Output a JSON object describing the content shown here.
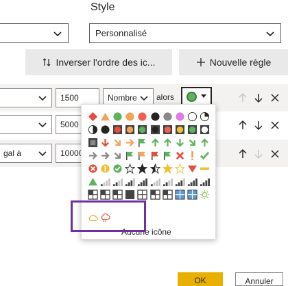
{
  "style": {
    "label": "Style",
    "selected": "Personnalisé"
  },
  "toolbar": {
    "reverse_label": "Inverser l'ordre des ic...",
    "new_rule_label": "Nouvelle règle"
  },
  "rules": [
    {
      "value": "1500",
      "type": "Nombre",
      "then": "alors",
      "icon_color": "#5fb35f"
    },
    {
      "value": "5000"
    },
    {
      "op_partial": "gal à",
      "value": "10000"
    }
  ],
  "icon_picker": {
    "no_icon_label": "Aucune icône",
    "rows": [
      [
        "diamond-red",
        "triangle-orange",
        "circle-green",
        "circle-orange",
        "circle-red",
        "circle-black",
        "circle-dark",
        "circle-pink",
        "circle-empty",
        "circle-quarter"
      ],
      [
        "circle-half",
        "circle-black-full",
        "circle-red-boxed",
        "circle-orange-boxed",
        "circle-green-boxed",
        "circle-black-boxed",
        "circle-red-boxed2",
        "circle-orange-boxed2",
        "circle-green-boxed2",
        "circle-empty-boxed"
      ],
      [
        "square-dark",
        "arrow-down-red",
        "arrow-downright-orange",
        "arrow-right-orange",
        "flag-green",
        "arrow-up-green",
        "arrow-up-green2",
        "arrow-down-green",
        "arrow-downright-green",
        "arrow-up-green3"
      ],
      [
        "arrow-right-gray",
        "arrow-right-gray2",
        "arrow-downright-gray",
        "flag-green2",
        "flag-orange",
        "flag-red",
        "flag-green3",
        "x-red",
        "exclaim-orange",
        "check-green"
      ],
      [
        "x-circle-red",
        "exclaim-circle-orange",
        "check-circle-green",
        "star-empty",
        "star-dark",
        "star-half",
        "star-gold",
        "star-outline-gold",
        "triangle-down-red",
        "bar-orange"
      ],
      [
        "triangle-up-green",
        "signal-1",
        "signal-2",
        "signal-3",
        "signal-4",
        "signal-5",
        "signal-6",
        "signal-7",
        "signal-8",
        "signal-9"
      ],
      [
        "quad-1",
        "quad-2",
        "quad-3",
        "square-black",
        "quad-4",
        "quad-5",
        "quad-6",
        "quad-blue",
        "quad-blue2",
        "sun-icon"
      ],
      [
        "cloud-icon",
        "cloud-rain-icon"
      ]
    ]
  },
  "footer": {
    "ok_label": "OK",
    "cancel_label": "Annuler"
  },
  "colors": {
    "accent": "#e8b000",
    "highlight_box": "#7030a0",
    "red": "#e74c3c",
    "orange": "#f4a259",
    "green": "#5fb35f",
    "gray": "#605e5c"
  }
}
